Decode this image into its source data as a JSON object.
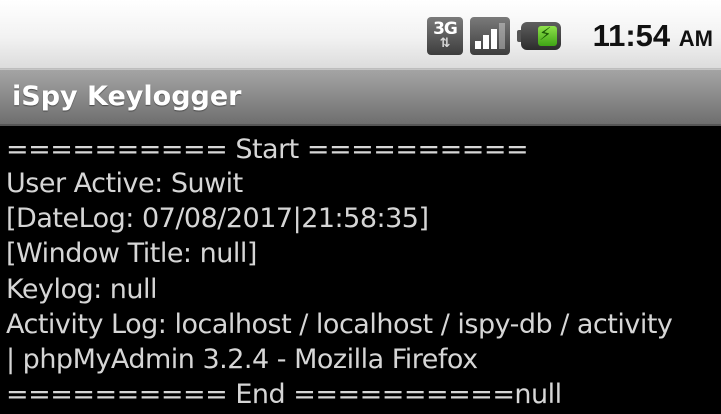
{
  "status_bar": {
    "network_type": "3G",
    "network_arrows": "⇅",
    "network_icon": "3g-data-icon",
    "signal_icon": "signal-strength-icon",
    "signal_level": 0.75,
    "battery_icon": "battery-charging-icon",
    "battery_level": 0.6,
    "time": "11:54",
    "ampm": "AM",
    "bg_color": "#f2f2f2"
  },
  "title_bar": {
    "title": "iSpy Keylogger",
    "bg_color": "#8a8a8a"
  },
  "log": {
    "text_color": "#d6d6d6",
    "bg_color": "#000000",
    "lines": [
      "========== Start ==========",
      "User Active: Suwit",
      "[DateLog: 07/08/2017|21:58:35]",
      "[Window Title: null]",
      "Keylog: null",
      "Activity Log: localhost / localhost / ispy-db / activity",
      "| phpMyAdmin 3.2.4 - Mozilla Firefox",
      "========== End ==========null"
    ]
  }
}
